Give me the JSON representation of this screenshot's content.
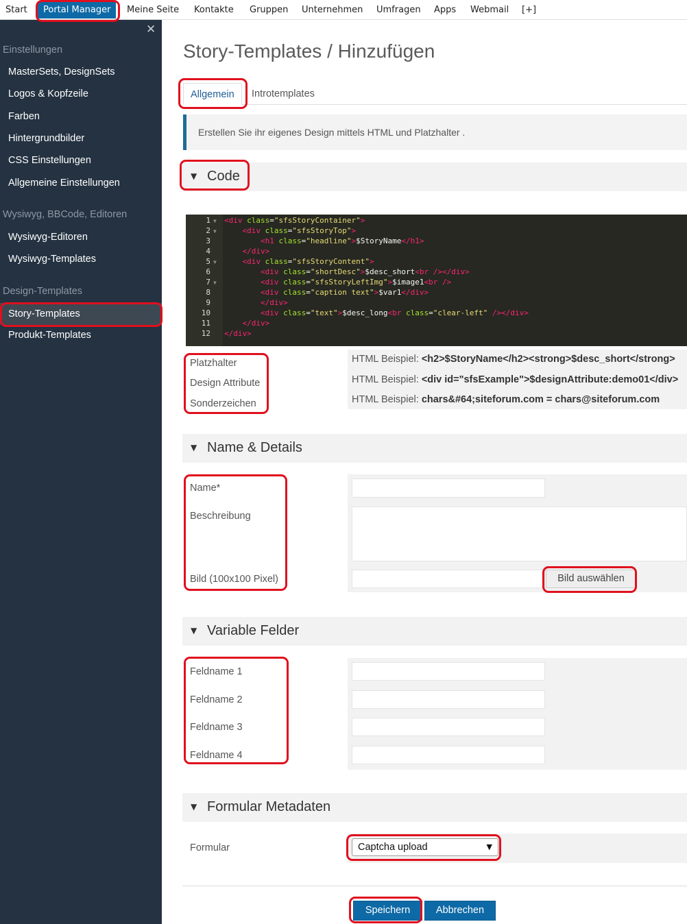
{
  "topnav": {
    "items": [
      "Start",
      "Portal Manager",
      "Meine Seite",
      "Kontakte",
      "Gruppen",
      "Unternehmen",
      "Umfragen",
      "Apps",
      "Webmail",
      "[+]"
    ]
  },
  "sidebar": {
    "close_glyph": "✕",
    "sections": [
      {
        "title": "Einstellungen",
        "items": [
          "MasterSets, DesignSets",
          "Logos & Kopfzeile",
          "Farben",
          "Hintergrundbilder",
          "CSS Einstellungen",
          "Allgemeine Einstellungen"
        ]
      },
      {
        "title": "Wysiwyg, BBCode, Editoren",
        "items": [
          "Wysiwyg-Editoren",
          "Wysiwyg-Templates"
        ]
      },
      {
        "title": "Design-Templates",
        "items": [
          "Story-Templates",
          "Produkt-Templates"
        ]
      }
    ]
  },
  "page": {
    "title": "Story-Templates / Hinzufügen",
    "tabs": [
      "Allgemein",
      "Introtemplates"
    ],
    "info": "Erstellen Sie ihr eigenes Design mittels HTML und Platzhalter ."
  },
  "sections": {
    "code": "Code",
    "details": "Name & Details",
    "variables": "Variable Felder",
    "meta": "Formular Metadaten"
  },
  "code_lines": [
    "<div class=\"sfsStoryContainer\">",
    "    <div class=\"sfsStoryTop\">",
    "        <h1 class=\"headline\">$StoryName</h1>",
    "    </div>",
    "    <div class=\"sfsStoryContent\">",
    "        <div class=\"shortDesc\">$desc_short<br /></div>",
    "        <div class=\"sfsStoryLeftImg\">$image1<br />",
    "        <div class=\"caption text\">$var1</div>",
    "        </div>",
    "        <div class=\"text\">$desc_long<br class=\"clear-left\" /></div>",
    "    </div>",
    "</div>"
  ],
  "help": {
    "labels": [
      "Platzhalter",
      "Design Attribute",
      "Sonderzeichen"
    ],
    "prefix": "HTML Beispiel:",
    "examples": [
      "<h2>$StoryName</h2><strong>$desc_short</strong>",
      "<div id=\"sfsExample\">$designAttribute:demo01</div>",
      "chars&#64;siteforum.com = chars@siteforum.com"
    ]
  },
  "details": {
    "name_label": "Name*",
    "desc_label": "Beschreibung",
    "image_label": "Bild (100x100 Pixel)",
    "choose_image": "Bild auswählen"
  },
  "variables": {
    "fields": [
      "Feldname 1",
      "Feldname 2",
      "Feldname 3",
      "Feldname 4"
    ]
  },
  "meta": {
    "form_label": "Formular",
    "form_value": "Captcha upload"
  },
  "actions": {
    "save": "Speichern",
    "cancel": "Abbrechen"
  },
  "colors": {
    "accent": "#0e6aa6",
    "sidebar": "#243241",
    "highlight": "#e0101e"
  }
}
